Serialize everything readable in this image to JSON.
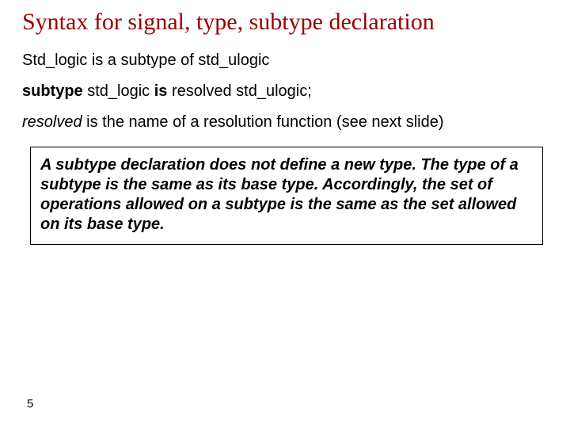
{
  "title": "Syntax for signal, type, subtype declaration",
  "line1": "Std_logic is a subtype of std_ulogic",
  "code": {
    "kw_subtype": "subtype",
    "name": " std_logic ",
    "kw_is": "is",
    "rest": " resolved std_ulogic;"
  },
  "line3": {
    "resolved": "resolved",
    "rest": " is the name of a resolution function (see next slide)"
  },
  "box_text": "A subtype declaration does not define a new type. The type of a subtype is the same as its base type. Accordingly, the set of operations allowed on a subtype is the same as the set allowed on its base type.",
  "page_number": "5"
}
